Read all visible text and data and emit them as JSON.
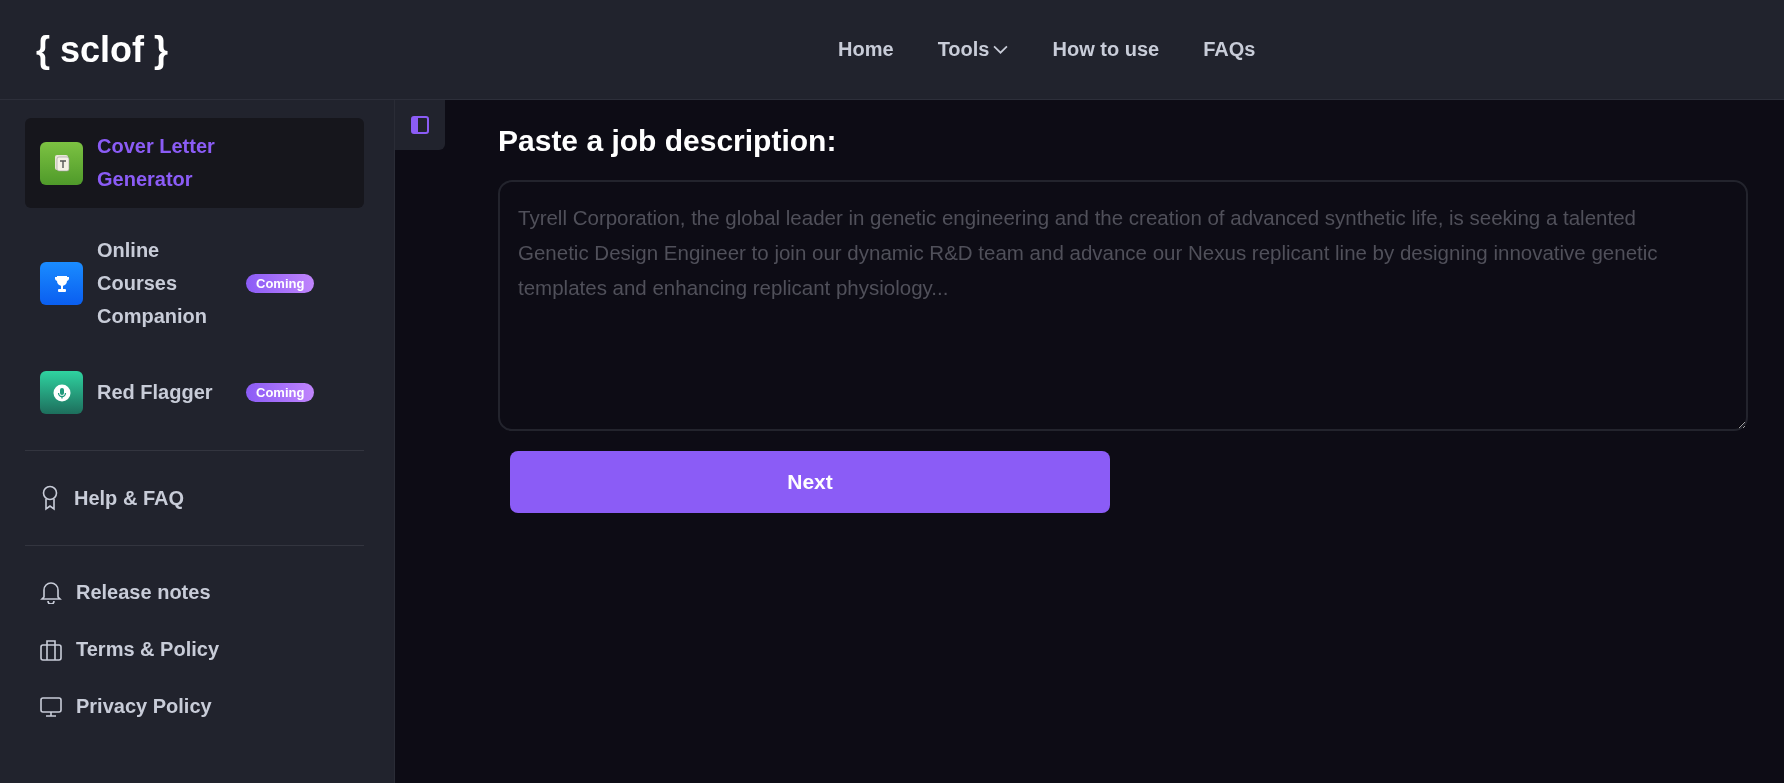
{
  "header": {
    "logo": "{ sclof }",
    "nav": [
      {
        "label": "Home",
        "dropdown": false
      },
      {
        "label": "Tools",
        "dropdown": true
      },
      {
        "label": "How to use",
        "dropdown": false
      },
      {
        "label": "FAQs",
        "dropdown": false
      }
    ]
  },
  "sidebar": {
    "tools": [
      {
        "label": "Cover Letter Generator",
        "kind": "document",
        "selected": true
      },
      {
        "label": "Online Courses Companion",
        "kind": "trophy",
        "selected": false,
        "badge": "Coming"
      },
      {
        "label": "Red Flagger",
        "kind": "microphone",
        "selected": false,
        "badge": "Coming"
      }
    ],
    "help": [
      {
        "label": "Help & FAQ",
        "kind": "ribbon"
      }
    ],
    "links": [
      {
        "label": "Release notes",
        "kind": "bell"
      },
      {
        "label": "Terms & Policy",
        "kind": "briefcase"
      },
      {
        "label": "Privacy Policy",
        "kind": "monitor"
      }
    ]
  },
  "main": {
    "heading": "Paste a job description:",
    "job_field": {
      "placeholder": "Tyrell Corporation, the global leader in genetic engineering and the creation of advanced synthetic life, is seeking a talented Genetic Design Engineer to join our dynamic R&D team and advance our Nexus replicant line by designing innovative genetic templates and enhancing replicant physiology..."
    },
    "button": "Next"
  }
}
